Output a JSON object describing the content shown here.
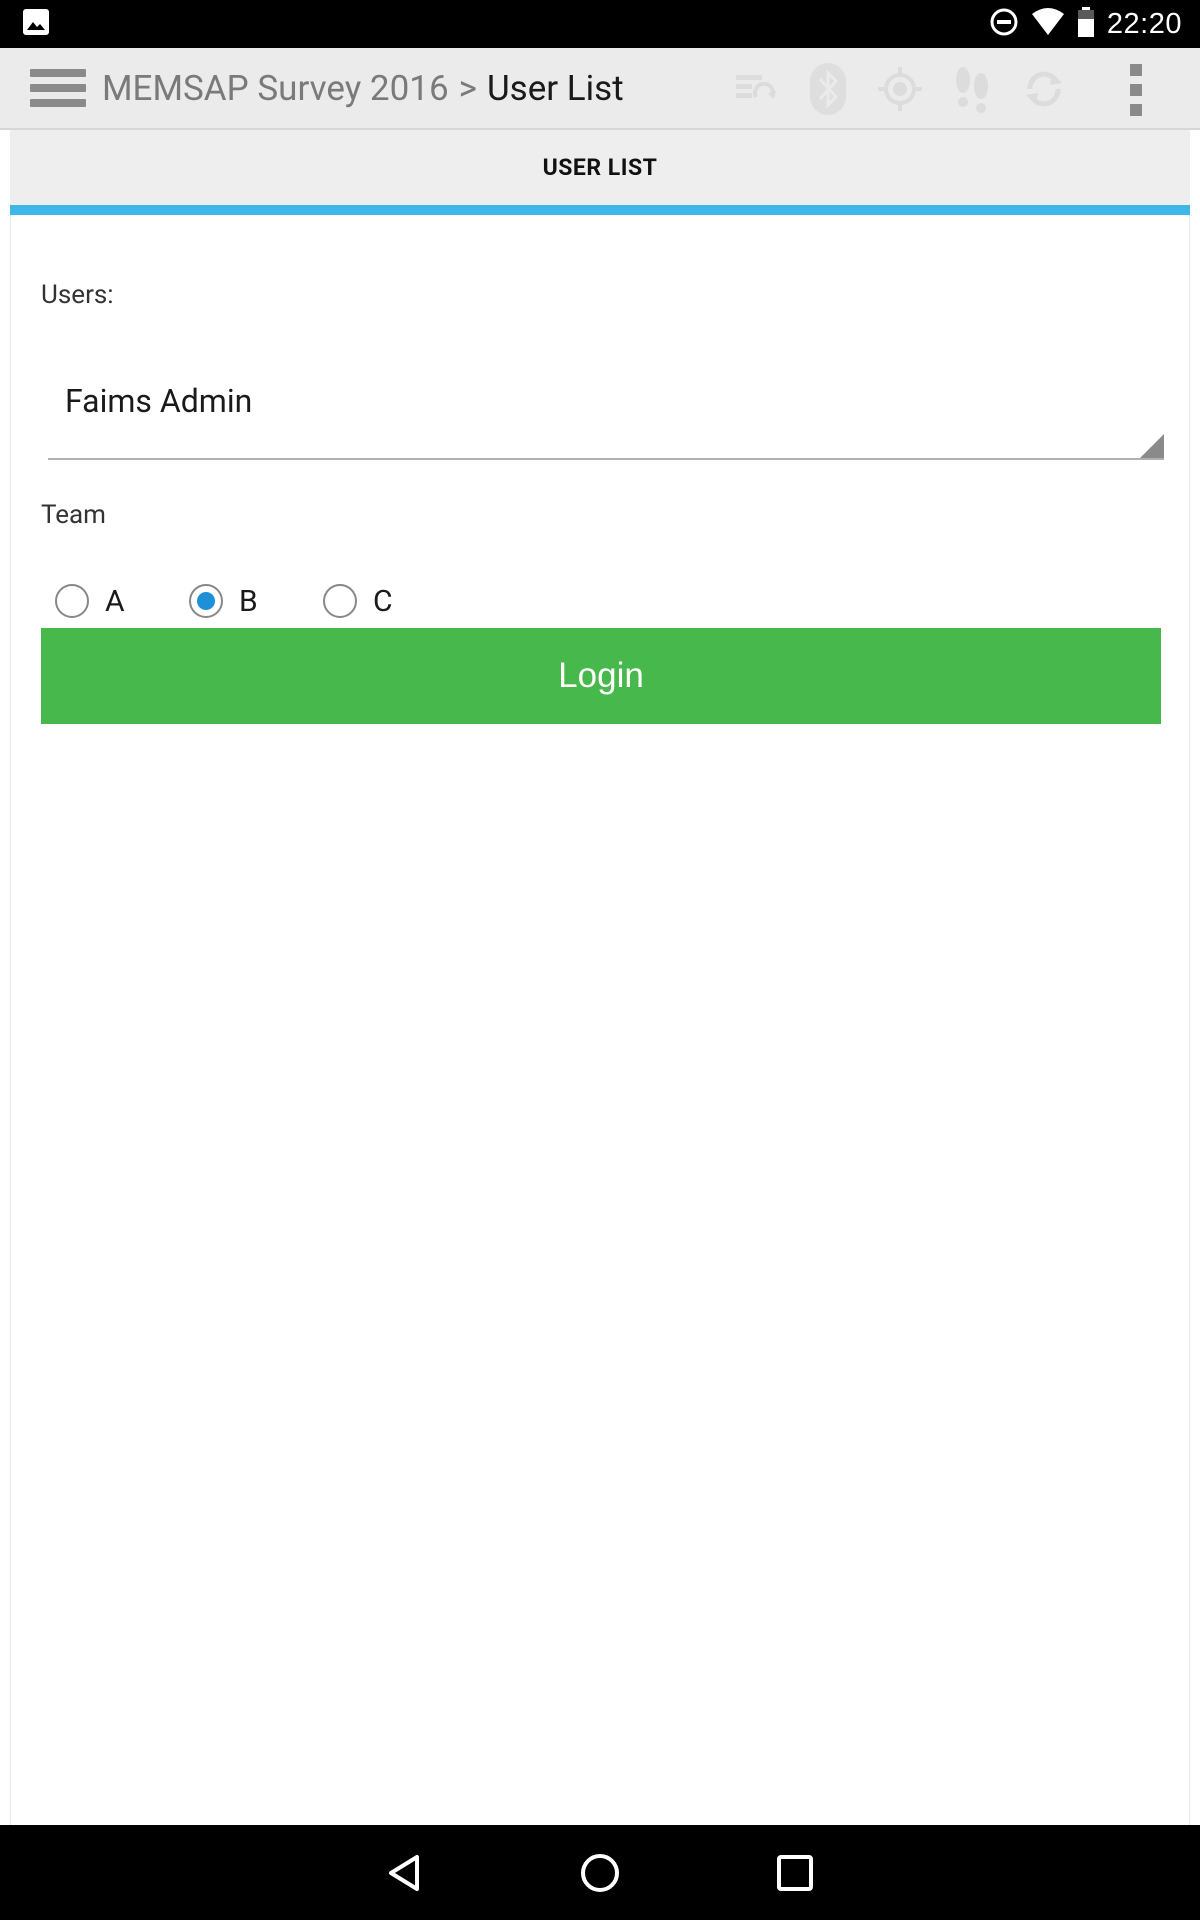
{
  "status_bar": {
    "time": "22:20",
    "icons": [
      "gallery-notification-icon",
      "do-not-disturb-icon",
      "wifi-icon",
      "battery-icon"
    ]
  },
  "app_bar": {
    "breadcrumb_parent": "MEMSAP Survey 2016",
    "breadcrumb_separator": ">",
    "breadcrumb_current": "User List",
    "action_icons": [
      "sync-status-icon",
      "bluetooth-icon",
      "gps-icon",
      "tracking-footprints-icon",
      "refresh-icon"
    ],
    "overflow_icon": "more-vert-icon"
  },
  "tab": {
    "label": "USER LIST",
    "indicator_color": "#3db8e8"
  },
  "form": {
    "users_label": "Users:",
    "users_selected": "Faims Admin",
    "team_label": "Team",
    "team_options": [
      {
        "label": "A",
        "checked": false
      },
      {
        "label": "B",
        "checked": true
      },
      {
        "label": "C",
        "checked": false
      }
    ],
    "login_label": "Login",
    "login_color": "#47b84b"
  },
  "nav_bar": {
    "buttons": [
      "back-icon",
      "home-icon",
      "recents-icon"
    ]
  }
}
